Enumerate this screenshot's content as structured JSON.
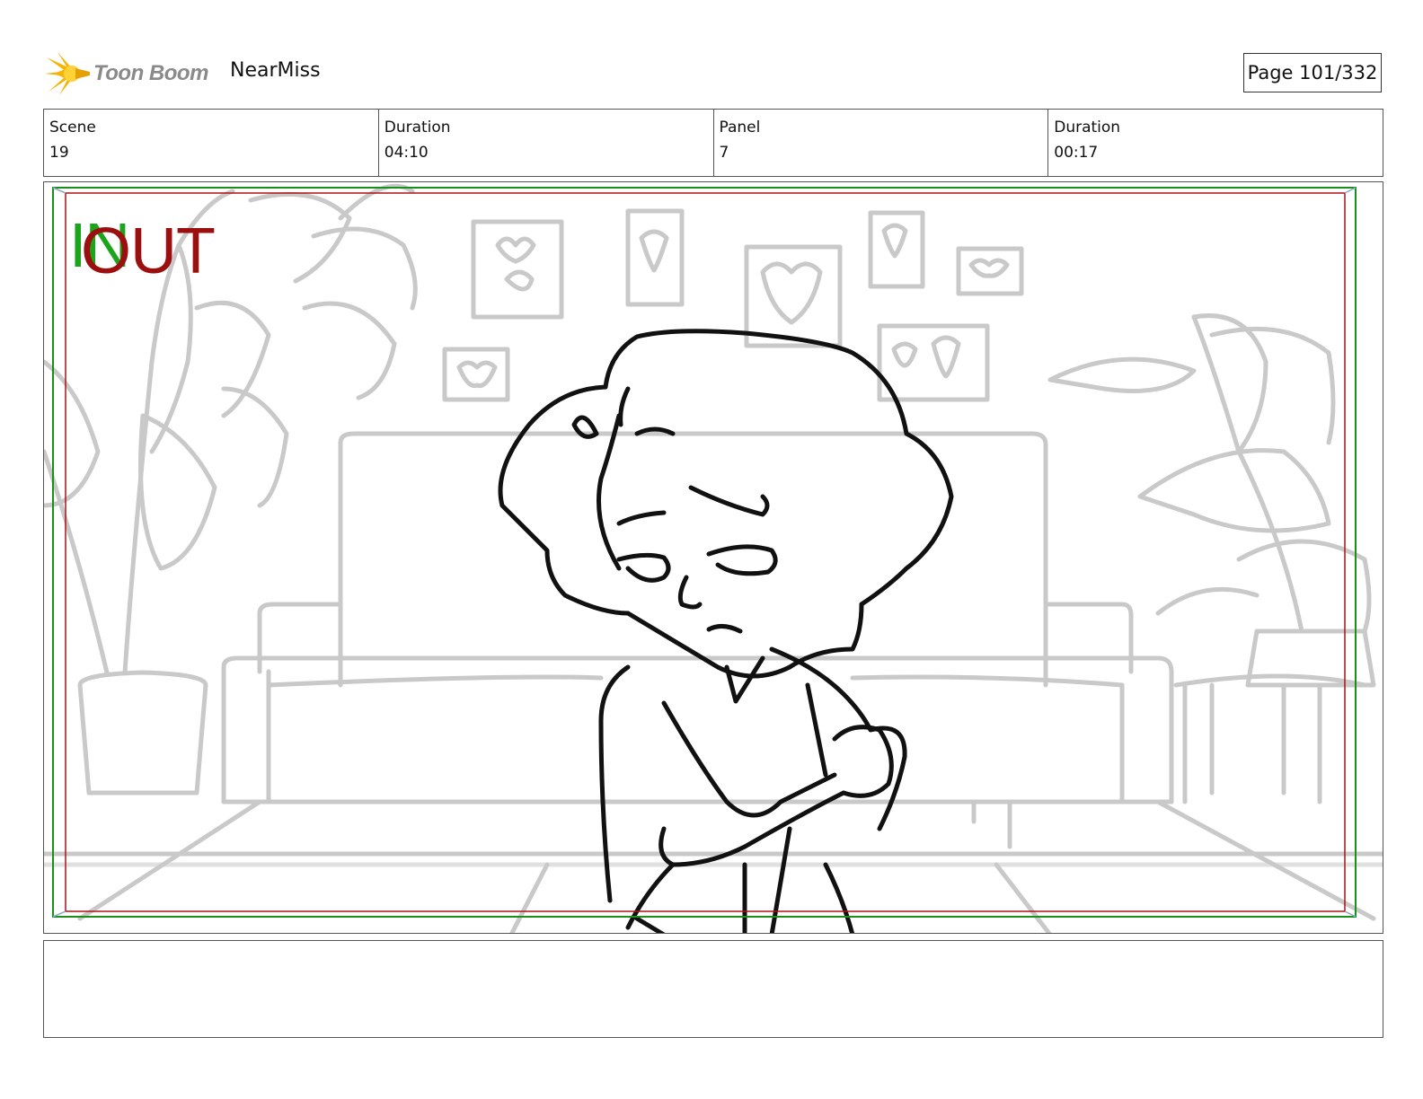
{
  "header": {
    "logo_text": "Toon Boom",
    "project_name": "NearMiss",
    "page_label": "Page 101/332"
  },
  "info": {
    "scene_label": "Scene",
    "scene_value": "19",
    "scene_duration_label": "Duration",
    "scene_duration_value": "04:10",
    "panel_label": "Panel",
    "panel_value": "7",
    "panel_duration_label": "Duration",
    "panel_duration_value": "00:17"
  },
  "panel": {
    "in_marker": "IN",
    "out_marker": "OUT",
    "safe_frame_color": "#1a8f1a",
    "action_frame_color": "#b01010"
  },
  "notes": {
    "text": ""
  }
}
